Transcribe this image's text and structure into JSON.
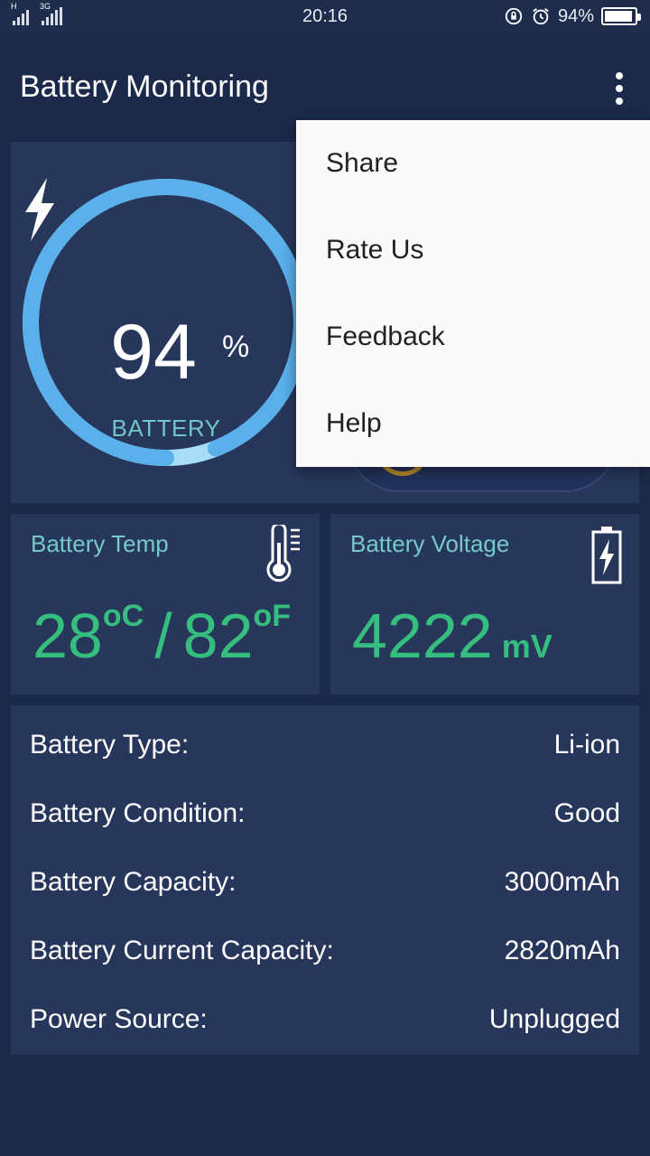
{
  "status_bar": {
    "time": "20:16",
    "battery_pct": "94%",
    "network_1": "H",
    "network_2": "3G",
    "battery_level": 0.94
  },
  "app_bar": {
    "title": "Battery Monitoring",
    "overflow_icon": "more-vert-icon"
  },
  "battery_dial": {
    "value": "94",
    "unit": "%",
    "label": "BATTERY",
    "level": 0.94,
    "ring_color": "#5ab0ea",
    "label_color": "#6ec6c6"
  },
  "temp_card": {
    "title": "Battery Temp",
    "celsius": "28",
    "celsius_unit": "oC",
    "separator": "/",
    "fahrenheit": "82",
    "fahrenheit_unit": "oF",
    "icon": "thermometer-icon"
  },
  "voltage_card": {
    "title": "Battery Voltage",
    "value": "4222",
    "unit": "mV",
    "icon": "battery-charging-icon"
  },
  "info": {
    "rows": [
      {
        "label": "Battery Type:",
        "value": "Li-ion"
      },
      {
        "label": "Battery Condition:",
        "value": "Good"
      },
      {
        "label": "Battery Capacity:",
        "value": "3000mAh"
      },
      {
        "label": "Battery Current Capacity:",
        "value": "2820mAh"
      },
      {
        "label": "Power Source:",
        "value": "Unplugged"
      }
    ]
  },
  "menu": {
    "items": [
      "Share",
      "Rate Us",
      "Feedback",
      "Help"
    ]
  },
  "colors": {
    "background": "#1b2a4a",
    "card": "#27375c",
    "accent_green": "#35be7e",
    "title_teal": "#76c9c9",
    "menu_bg": "#fafafa"
  }
}
